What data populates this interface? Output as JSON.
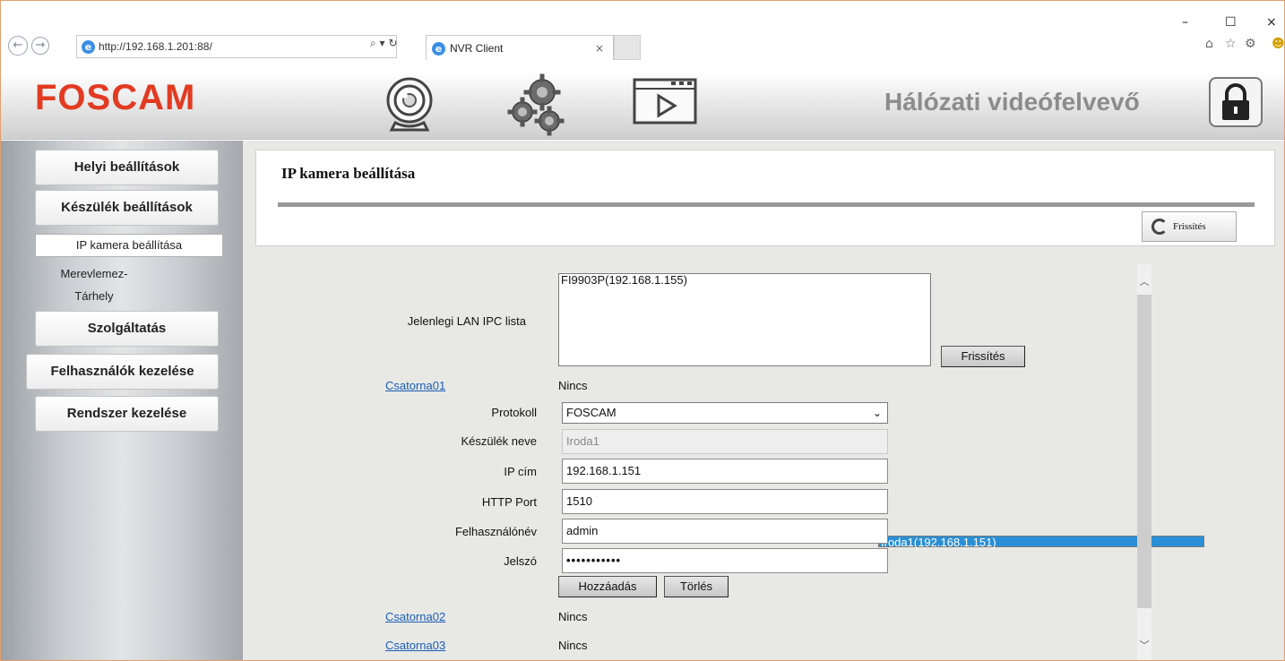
{
  "browser": {
    "url": "http://192.168.1.201:88/",
    "search_ctl": "⌕ ▾ ↻",
    "tab_title": "NVR Client",
    "tab_close": "×",
    "win_min": "–",
    "win_max": "☐",
    "win_close": "×",
    "home": "⌂",
    "star": "☆",
    "gear": "⚙",
    "smiley": "☻",
    "back": "←",
    "forward": "→"
  },
  "header": {
    "logo": "FOSCAM",
    "title": "Hálózati videófelvevő",
    "icons": [
      "camera-icon",
      "gears-icon",
      "playback-icon",
      "lock-icon"
    ]
  },
  "sidebar": {
    "items": [
      {
        "label": "Helyi beállítások"
      },
      {
        "label": "Készülék beállítások"
      },
      {
        "label": "Szolgáltatás"
      },
      {
        "label": "Felhasználók kezelése"
      },
      {
        "label": "Rendszer kezelése"
      }
    ],
    "subitems": [
      {
        "label": "IP kamera beállítása",
        "active": true
      },
      {
        "label": "Merevlemez-"
      },
      {
        "label": "Tárhely"
      }
    ]
  },
  "page": {
    "title": "IP kamera beállítása",
    "refresh_top": "Frissítés",
    "lan_list_label": "Jelenlegi LAN IPC lista",
    "lan_list": [
      "FI9903P(192.168.1.155)",
      "Iroda1(192.168.1.151)"
    ],
    "lan_selected": "Iroda1(192.168.1.151)",
    "refresh_list": "Frissítés",
    "channel1": {
      "name": "Csatorna01",
      "status": "Nincs"
    },
    "fields": {
      "protocol_label": "Protokoll",
      "protocol_value": "FOSCAM",
      "device_label": "Készülék neve",
      "device_value": "Iroda1",
      "ip_label": "IP cím",
      "ip_value": "192.168.1.151",
      "port_label": "HTTP Port",
      "port_value": "1510",
      "user_label": "Felhasználónév",
      "user_value": "admin",
      "pass_label": "Jelszó",
      "pass_value": "•••••••••••"
    },
    "add_button": "Hozzáadás",
    "delete_button": "Törlés",
    "channel2": {
      "name": "Csatorna02",
      "status": "Nincs"
    },
    "channel3": {
      "name": "Csatorna03",
      "status": "Nincs"
    },
    "scroll_up": "︿",
    "scroll_down": "﹀"
  }
}
